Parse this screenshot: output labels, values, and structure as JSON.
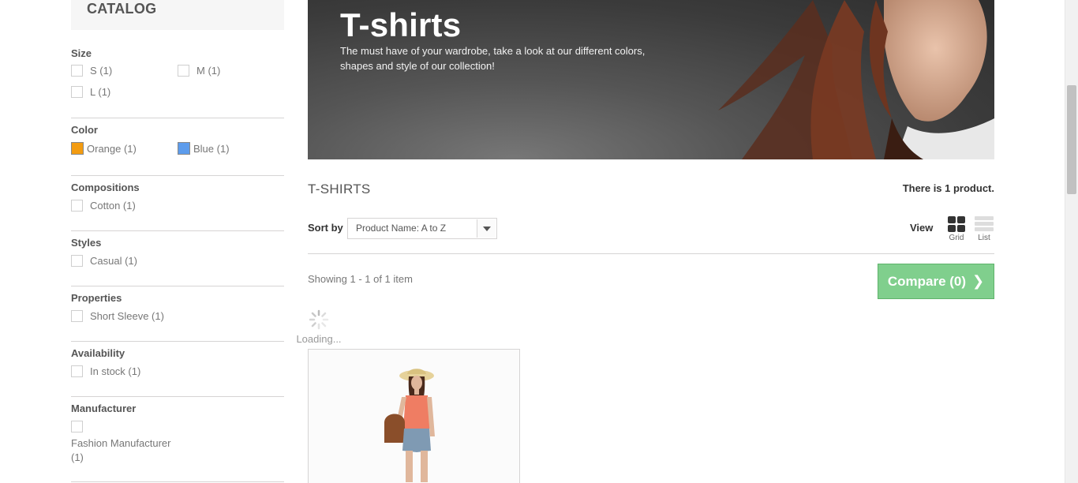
{
  "sidebar": {
    "catalog_title": "CATALOG",
    "filters": [
      {
        "title": "Size",
        "options": [
          {
            "label": "S (1)"
          },
          {
            "label": "M (1)"
          },
          {
            "label": "L (1)"
          }
        ]
      },
      {
        "title": "Color",
        "options": [
          {
            "label": "Orange (1)",
            "color": "#f39c11"
          },
          {
            "label": "Blue (1)",
            "color": "#5d9cec"
          }
        ]
      },
      {
        "title": "Compositions",
        "options": [
          {
            "label": "Cotton (1)"
          }
        ]
      },
      {
        "title": "Styles",
        "options": [
          {
            "label": "Casual (1)"
          }
        ]
      },
      {
        "title": "Properties",
        "options": [
          {
            "label": "Short Sleeve (1)"
          }
        ]
      },
      {
        "title": "Availability",
        "options": [
          {
            "label": "In stock (1)"
          }
        ]
      },
      {
        "title": "Manufacturer",
        "options": [
          {
            "label": "Fashion Manufacturer (1)"
          }
        ]
      }
    ]
  },
  "banner": {
    "title": "T-shirts",
    "description": "The must have of your wardrobe, take a look at our different colors, shapes and style of our collection!"
  },
  "category": {
    "title": "T-SHIRTS",
    "product_count": "There is 1 product."
  },
  "sort": {
    "label": "Sort by",
    "selected": "Product Name: A to Z"
  },
  "view": {
    "label": "View",
    "grid_label": "Grid",
    "list_label": "List"
  },
  "showing": "Showing 1 - 1 of 1 item",
  "compare": {
    "label": "Compare (0)",
    "color": "#80cf8d"
  },
  "loading": "Loading..."
}
